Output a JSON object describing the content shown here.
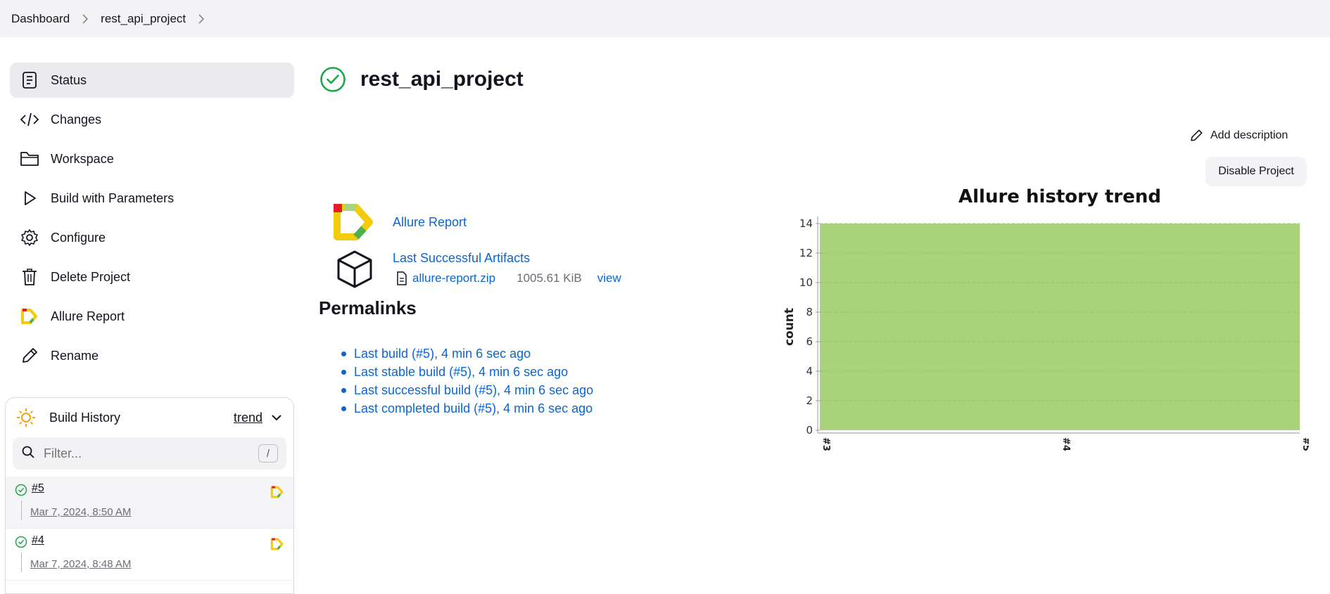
{
  "breadcrumb": {
    "items": [
      "Dashboard",
      "rest_api_project"
    ]
  },
  "sidebar": {
    "items": [
      {
        "label": "Status",
        "icon": "status-icon"
      },
      {
        "label": "Changes",
        "icon": "code-icon"
      },
      {
        "label": "Workspace",
        "icon": "folder-icon"
      },
      {
        "label": "Build with Parameters",
        "icon": "play-icon"
      },
      {
        "label": "Configure",
        "icon": "gear-icon"
      },
      {
        "label": "Delete Project",
        "icon": "trash-icon"
      },
      {
        "label": "Allure Report",
        "icon": "allure-icon"
      },
      {
        "label": "Rename",
        "icon": "pencil-icon"
      }
    ]
  },
  "build_history": {
    "title": "Build History",
    "trend_label": "trend",
    "filter_placeholder": "Filter...",
    "filter_shortcut": "/",
    "builds": [
      {
        "number": "#5",
        "time": "Mar 7, 2024, 8:50 AM"
      },
      {
        "number": "#4",
        "time": "Mar 7, 2024, 8:48 AM"
      }
    ]
  },
  "main": {
    "title": "rest_api_project",
    "add_description": "Add description",
    "disable_button": "Disable Project",
    "allure_report_link": "Allure Report",
    "artifacts_link": "Last Successful Artifacts",
    "artifact_file": "allure-report.zip",
    "artifact_size": "1005.61 KiB",
    "artifact_view": "view",
    "permalinks_heading": "Permalinks",
    "permalinks": [
      "Last build (#5), 4 min 6 sec ago",
      "Last stable build (#5), 4 min 6 sec ago",
      "Last successful build (#5), 4 min 6 sec ago",
      "Last completed build (#5), 4 min 6 sec ago"
    ]
  },
  "colors": {
    "link": "#0a66d2",
    "success": "#1ea64b",
    "chart_fill": "#a9d37a"
  },
  "chart_data": {
    "type": "area",
    "title": "Allure history trend",
    "ylabel": "count",
    "xlabel": "",
    "categories": [
      "#3",
      "#4",
      "#5"
    ],
    "series": [
      {
        "values": [
          14,
          14,
          14
        ]
      }
    ],
    "ylim": [
      0,
      14
    ],
    "yticks": [
      0,
      2,
      4,
      6,
      8,
      10,
      12,
      14
    ],
    "grid": true,
    "legend": "none"
  }
}
